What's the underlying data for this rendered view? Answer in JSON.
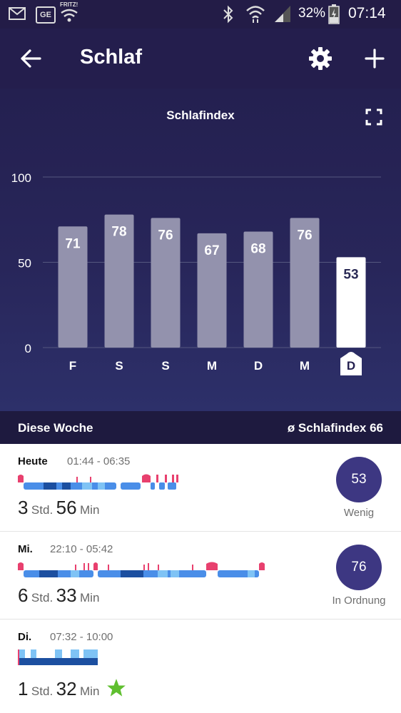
{
  "status_bar": {
    "battery": "32%",
    "time": "07:14",
    "wifi_badge": "FRITZ!",
    "app_badge": "GE"
  },
  "app_bar": {
    "title": "Schlaf"
  },
  "chart_data": {
    "type": "bar",
    "title": "Schlafindex",
    "categories": [
      "F",
      "S",
      "S",
      "M",
      "D",
      "M",
      "D"
    ],
    "values": [
      71,
      78,
      76,
      67,
      68,
      76,
      53
    ],
    "ylim": [
      0,
      100
    ],
    "yticks": [
      0,
      50,
      100
    ],
    "highlighted_index": 6,
    "grid": true
  },
  "pager": {
    "pages": 4,
    "active": 0
  },
  "week_header": {
    "left": "Diese Woche",
    "right": "ø Schlafindex 66"
  },
  "entries": [
    {
      "day": "Heute",
      "time": "01:44 - 06:35",
      "hours": "3",
      "hours_unit": "Std.",
      "minutes": "56",
      "minutes_unit": "Min",
      "score": "53",
      "score_label": "Wenig"
    },
    {
      "day": "Mi.",
      "time": "22:10 - 05:42",
      "hours": "6",
      "hours_unit": "Std.",
      "minutes": "33",
      "minutes_unit": "Min",
      "score": "76",
      "score_label": "In Ordnung"
    },
    {
      "day": "Di.",
      "time": "07:32 - 10:00",
      "hours": "1",
      "hours_unit": "Std.",
      "minutes": "32",
      "minutes_unit": "Min",
      "badge_icon": "star-icon"
    }
  ],
  "colors": {
    "bar": "#9392ad",
    "bar_highlight": "#ffffff",
    "score_circle": "#3d3782",
    "awake": "#e8406e",
    "light": "#4a8ee8",
    "deep": "#1c4fa0",
    "rem": "#7fc3f5",
    "star": "#5fbf2f"
  }
}
